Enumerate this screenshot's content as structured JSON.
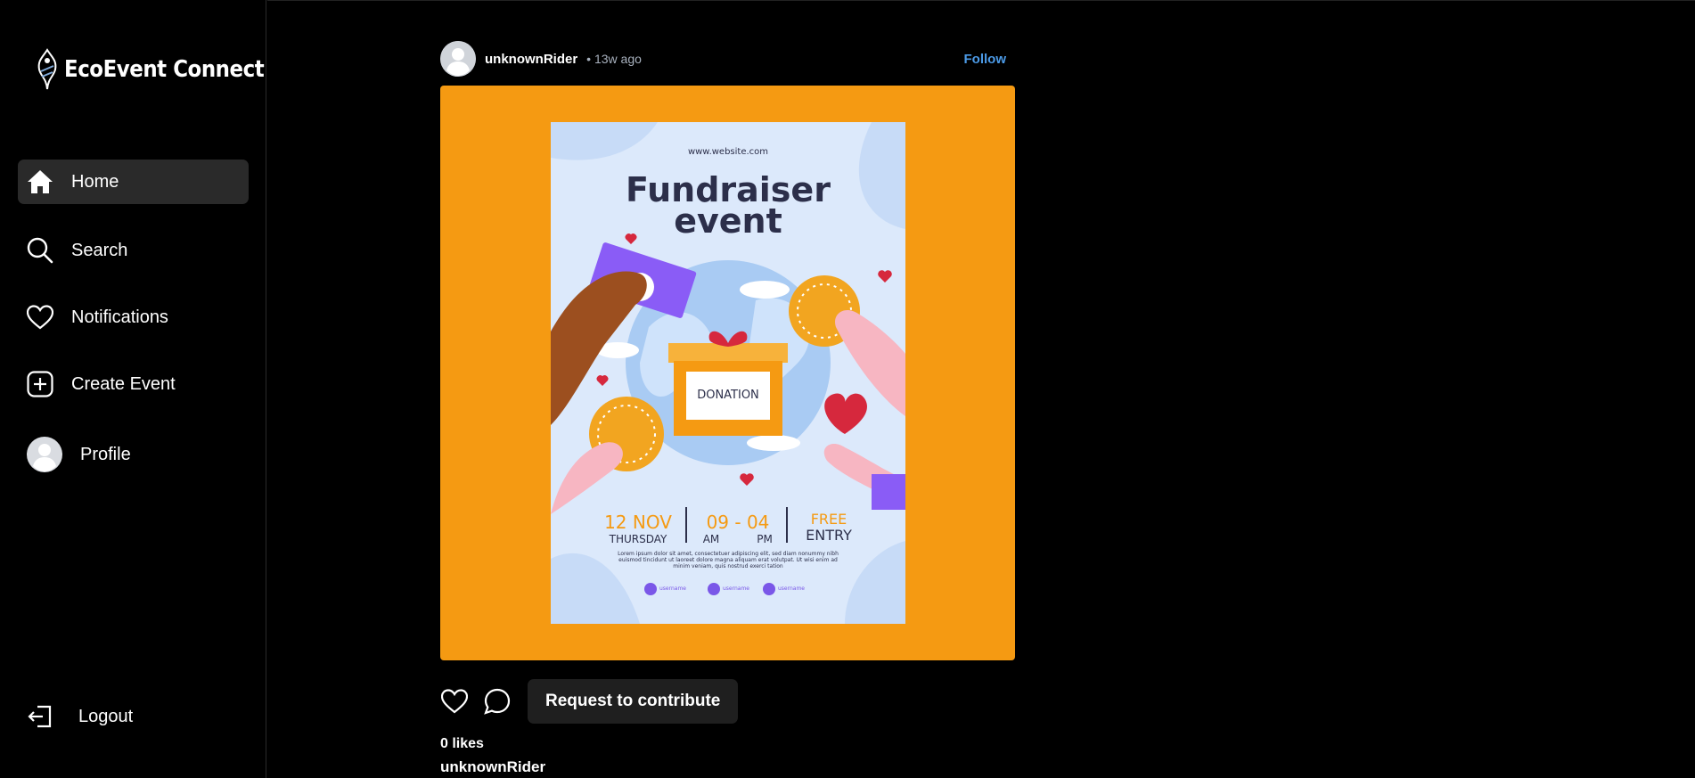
{
  "app": {
    "logo_text": "EcoEvent Connect"
  },
  "sidebar": {
    "items": [
      {
        "label": "Home",
        "icon": "home-icon",
        "active": true
      },
      {
        "label": "Search",
        "icon": "search-icon"
      },
      {
        "label": "Notifications",
        "icon": "heart-icon"
      },
      {
        "label": "Create Event",
        "icon": "plus-square-icon"
      },
      {
        "label": "Profile",
        "icon": "avatar"
      }
    ],
    "logout_label": "Logout"
  },
  "post": {
    "username": "unknownRider",
    "time": "• 13w ago",
    "follow_label": "Follow",
    "media_bg": "#f59a12",
    "poster": {
      "website": "www.website.com",
      "title_line1": "Fundraiser",
      "title_line2": "event",
      "box_label": "DONATION",
      "date": "12 NOV",
      "day": "THURSDAY",
      "time": "09 - 04",
      "am": "AM",
      "pm": "PM",
      "free": "FREE",
      "entry": "ENTRY",
      "body_text": "Lorem ipsum dolor sit amet, consectetuer adipiscing elit, sed diam nonummy nibh euismod tincidunt ut laoreet dolore magna aliquam erat volutpat. Ut wisi enim ad minim veniam, quis nostrud exerci tation",
      "social": [
        "username",
        "username",
        "username"
      ]
    },
    "contribute_label": "Request to contribute",
    "likes": "0 likes",
    "caption_user": "unknownRider"
  },
  "colors": {
    "accent_link": "#4c9be8",
    "active_nav": "#2a2a2a"
  }
}
